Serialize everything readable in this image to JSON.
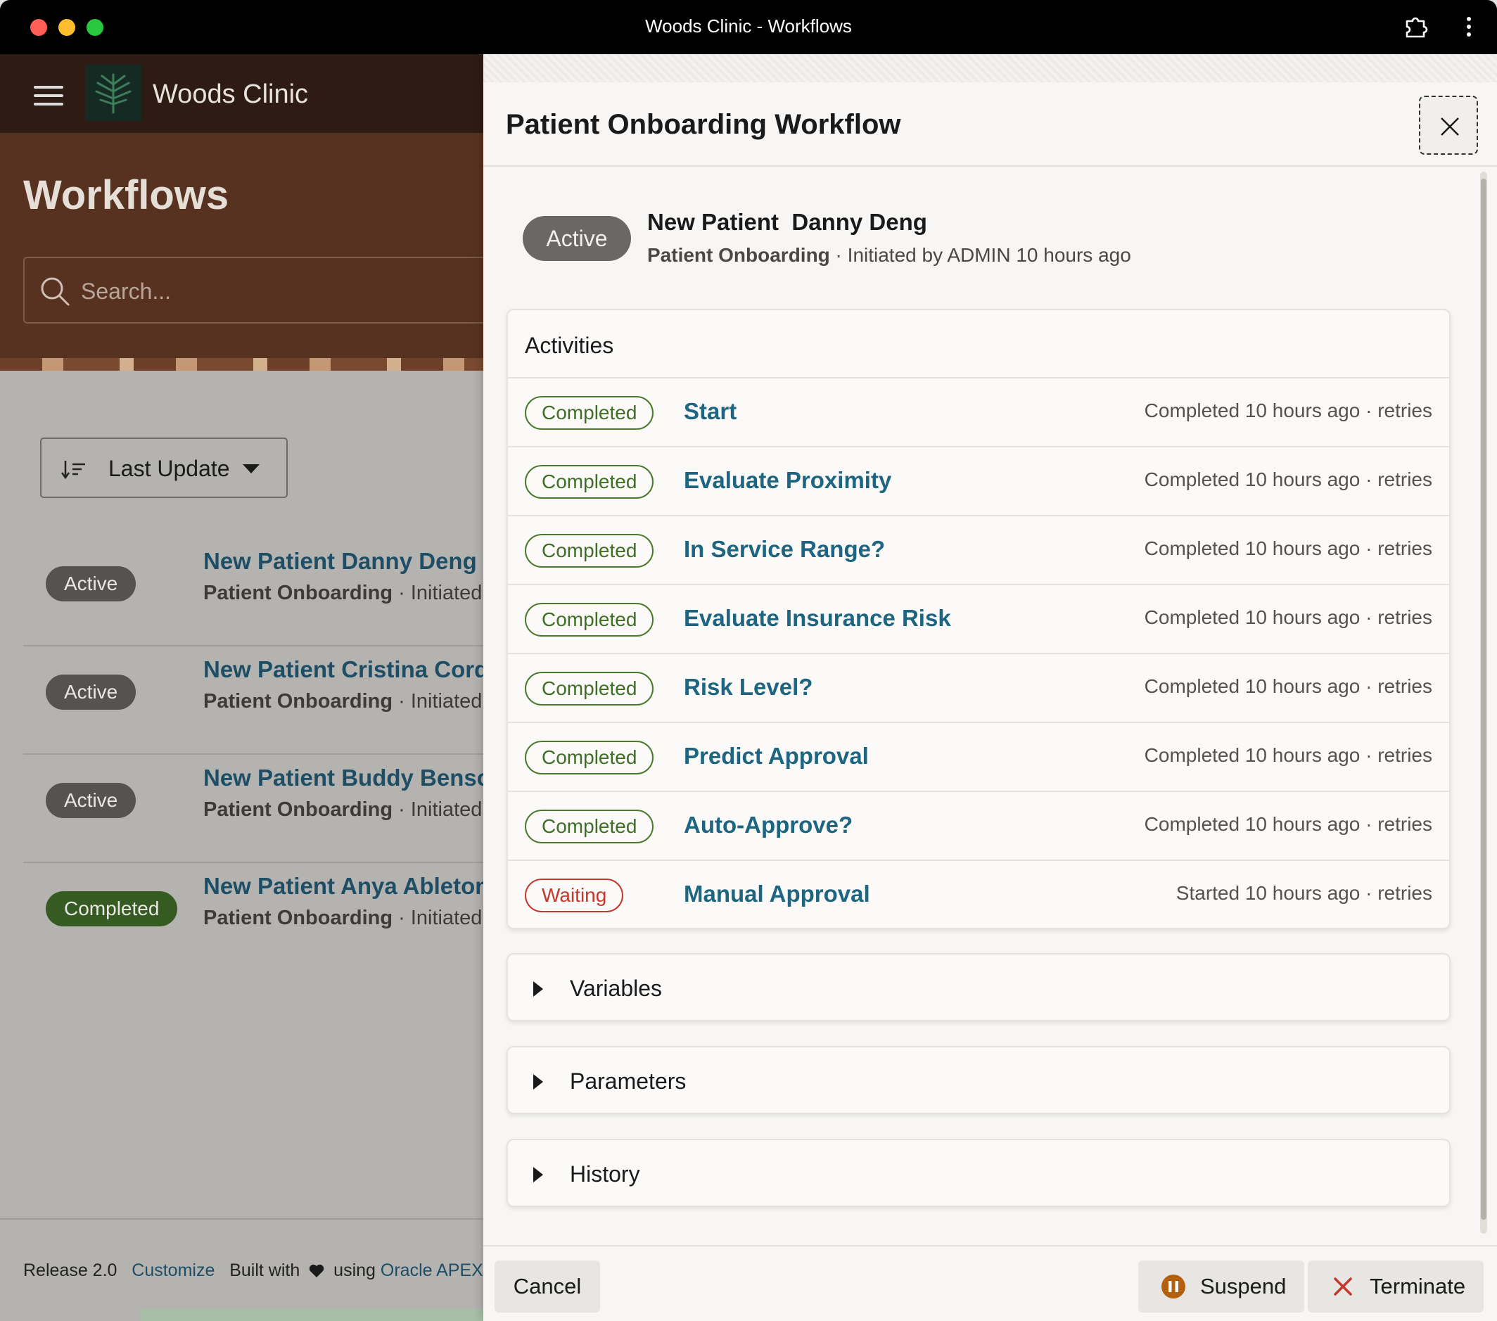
{
  "window": {
    "title": "Woods Clinic - Workflows"
  },
  "app": {
    "name": "Woods Clinic",
    "page_title": "Workflows",
    "search": {
      "placeholder": "Search...",
      "value": ""
    },
    "sort": {
      "label": "Last Update"
    },
    "workflows": [
      {
        "status": "Active",
        "status_kind": "active",
        "title": "New Patient Danny Deng",
        "type": "Patient Onboarding",
        "sub": " · Initiated b"
      },
      {
        "status": "Active",
        "status_kind": "active",
        "title": "New Patient Cristina Cordero",
        "type": "Patient Onboarding",
        "sub": " · Initiated b"
      },
      {
        "status": "Active",
        "status_kind": "active",
        "title": "New Patient Buddy Benson",
        "type": "Patient Onboarding",
        "sub": " · Initiated b"
      },
      {
        "status": "Completed",
        "status_kind": "completed",
        "title": "New Patient Anya Ableton",
        "type": "Patient Onboarding",
        "sub": " · Initiated b"
      }
    ],
    "footer": {
      "release": "Release 2.0",
      "customize": "Customize",
      "built_with": "Built with",
      "using": "using",
      "oracle_apex": "Oracle APEX"
    }
  },
  "drawer": {
    "title": "Patient Onboarding Workflow",
    "status": "Active",
    "instance_title": "New Patient  Danny Deng",
    "workflow_name": "Patient Onboarding",
    "initiated": " · Initiated by ADMIN 10 hours ago",
    "activities_title": "Activities",
    "activities": [
      {
        "status": "Completed",
        "kind": "completed",
        "name": "Start",
        "meta": "Completed 10 hours ago · retries"
      },
      {
        "status": "Completed",
        "kind": "completed",
        "name": "Evaluate Proximity",
        "meta": "Completed 10 hours ago · retries"
      },
      {
        "status": "Completed",
        "kind": "completed",
        "name": "In Service Range?",
        "meta": "Completed 10 hours ago · retries"
      },
      {
        "status": "Completed",
        "kind": "completed",
        "name": "Evaluate Insurance Risk",
        "meta": "Completed 10 hours ago · retries"
      },
      {
        "status": "Completed",
        "kind": "completed",
        "name": "Risk Level?",
        "meta": "Completed 10 hours ago · retries"
      },
      {
        "status": "Completed",
        "kind": "completed",
        "name": "Predict Approval",
        "meta": "Completed 10 hours ago · retries"
      },
      {
        "status": "Completed",
        "kind": "completed",
        "name": "Auto-Approve?",
        "meta": "Completed 10 hours ago · retries"
      },
      {
        "status": "Waiting",
        "kind": "waiting",
        "name": "Manual Approval",
        "meta": "Started 10 hours ago · retries"
      }
    ],
    "sections": {
      "variables": "Variables",
      "parameters": "Parameters",
      "history": "History"
    },
    "buttons": {
      "cancel": "Cancel",
      "suspend": "Suspend",
      "terminate": "Terminate"
    }
  }
}
